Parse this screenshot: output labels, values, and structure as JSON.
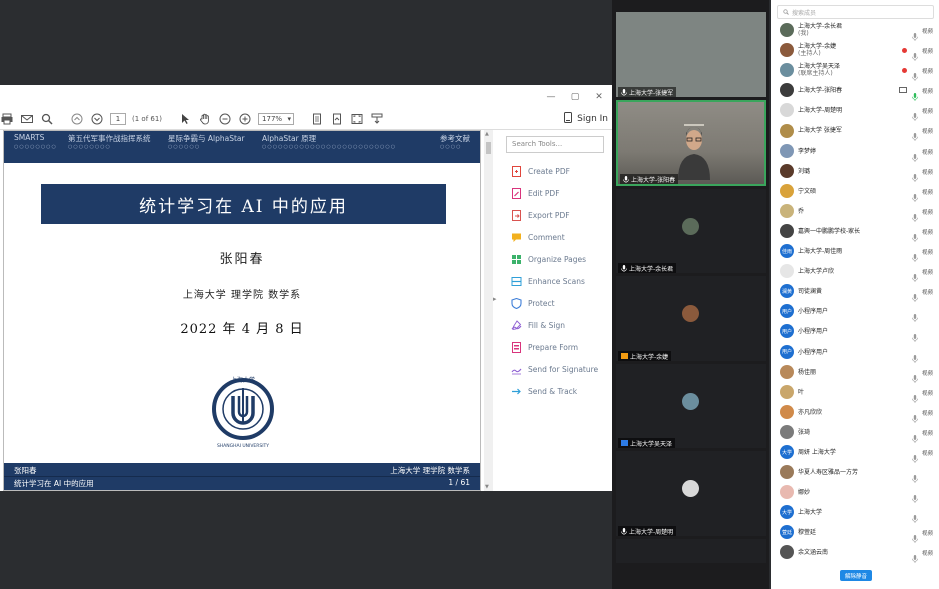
{
  "pdf": {
    "window_controls": [
      "—",
      "▢",
      "✕"
    ],
    "page_current": "1",
    "page_of": "(1 of 61)",
    "zoom": "177%",
    "sign_in": "Sign In",
    "tools_search_placeholder": "Search Tools...",
    "tools": [
      {
        "label": "Create PDF",
        "icon": "create-pdf-icon",
        "color": "#e0463c"
      },
      {
        "label": "Edit PDF",
        "icon": "edit-pdf-icon",
        "color": "#d9347c"
      },
      {
        "label": "Export PDF",
        "icon": "export-pdf-icon",
        "color": "#d9534f"
      },
      {
        "label": "Comment",
        "icon": "comment-icon",
        "color": "#f2b01e"
      },
      {
        "label": "Organize Pages",
        "icon": "organize-pages-icon",
        "color": "#3bb26b"
      },
      {
        "label": "Enhance Scans",
        "icon": "enhance-scans-icon",
        "color": "#2f9fd8"
      },
      {
        "label": "Protect",
        "icon": "protect-icon",
        "color": "#3f7fd8"
      },
      {
        "label": "Fill & Sign",
        "icon": "fill-sign-icon",
        "color": "#8e5fd3"
      },
      {
        "label": "Prepare Form",
        "icon": "prepare-form-icon",
        "color": "#d9347c"
      },
      {
        "label": "Send for Signature",
        "icon": "send-signature-icon",
        "color": "#8e5fd3"
      },
      {
        "label": "Send & Track",
        "icon": "send-track-icon",
        "color": "#2f9fd8"
      }
    ]
  },
  "slide": {
    "nav": [
      "SMARTS",
      "第五代军事作战指挥系统",
      "星际争霸与 AlphaStar",
      "AlphaStar 原理",
      "参考文献"
    ],
    "nav_dots": [
      "○○○○○○○○",
      "○○○○○○○○",
      "○○○○○○",
      "○○○○○○○○○○○○○○○○○○○○○○○○○",
      "○○○○"
    ],
    "title": "统计学习在 AI 中的应用",
    "author": "张阳春",
    "affiliation": "上海大学 理学院 数学系",
    "date": "2022 年 4 月 8 日",
    "logo_top": "上海大学",
    "logo_ring": "SHANGHAI UNIVERSITY",
    "footer_left_1": "张阳春",
    "footer_left_2": "统计学习在 AI 中的应用",
    "footer_right_1": "上海大学 理学院 数学系",
    "footer_right_2": "1 / 61",
    "navy": "#1f3b66"
  },
  "videos": [
    {
      "name": "上海大学-张捷军",
      "type": "blank"
    },
    {
      "name": "上海大学-张阳春",
      "type": "camera"
    },
    {
      "name": "上海大学-余长君",
      "type": "avatar"
    },
    {
      "name": "上海大学-余婕",
      "type": "avatar"
    },
    {
      "name": "上海大学吴天泽",
      "type": "avatar"
    },
    {
      "name": "上海大学-周楚明",
      "type": "avatar"
    }
  ],
  "participants": {
    "search_placeholder": "搜索成员",
    "unmute_all": "解除静音",
    "cam_label": "视频",
    "rows": [
      {
        "name": "上海大学-余长君",
        "sub": "(我)",
        "avatar_color": "#5b6b5a",
        "mic": "gray",
        "cam": true
      },
      {
        "name": "上海大学-余婕",
        "sub": "(主持人)",
        "avatar_color": "#8b5a3c",
        "mic": "gray",
        "cam": true,
        "rec": true
      },
      {
        "name": "上海大学吴天泽",
        "sub": "(联席主持人)",
        "avatar_color": "#6b8e9e",
        "mic": "gray",
        "cam": true,
        "rec": true
      },
      {
        "name": "上海大学-张阳春",
        "sub": "",
        "avatar_color": "#3c3c3c",
        "mic": "green",
        "cam": true,
        "screen": true
      },
      {
        "name": "上海大学-周楚明",
        "sub": "",
        "avatar_color": "#d8d8d8",
        "mic": "gray",
        "cam": true
      },
      {
        "name": "上海大学 张捷军",
        "sub": "",
        "avatar_color": "#b08d4a",
        "mic": "gray",
        "cam": true
      },
      {
        "name": "李梦婷",
        "sub": "",
        "avatar_color": "#7f97b5",
        "mic": "gray",
        "cam": true
      },
      {
        "name": "刘璐",
        "sub": "",
        "avatar_color": "#5a3a2a",
        "mic": "gray",
        "cam": true
      },
      {
        "name": "宁文硕",
        "sub": "",
        "avatar_color": "#d9a23a",
        "mic": "gray",
        "cam": true
      },
      {
        "name": "乔",
        "sub": "",
        "avatar_color": "#c9b37a",
        "mic": "gray",
        "cam": true
      },
      {
        "name": "嘉興一中鹏鹏学校-家长",
        "sub": "",
        "avatar_color": "#444444",
        "mic": "gray",
        "cam": true
      },
      {
        "name": "上海大学-周佳雨",
        "sub": "",
        "avatar_color": "#1e6fd0",
        "badge": "佳雨",
        "mic": "gray",
        "cam": true
      },
      {
        "name": "上海大学卢欣",
        "sub": "",
        "avatar_color": "#e6e6e6",
        "mic": "gray",
        "cam": true
      },
      {
        "name": "司徒澜黄",
        "sub": "",
        "avatar_color": "#1e6fd0",
        "badge": "澜黄",
        "mic": "gray",
        "cam": true
      },
      {
        "name": "小程序用户",
        "sub": "",
        "avatar_color": "#1e6fd0",
        "badge": "用户",
        "mic": "gray",
        "cam": false
      },
      {
        "name": "小程序用户",
        "sub": "",
        "avatar_color": "#1e6fd0",
        "badge": "用户",
        "mic": "gray",
        "cam": false
      },
      {
        "name": "小程序用户",
        "sub": "",
        "avatar_color": "#1e6fd0",
        "badge": "用户",
        "mic": "gray",
        "cam": false
      },
      {
        "name": "杨佳丽",
        "sub": "",
        "avatar_color": "#b8895a",
        "mic": "gray",
        "cam": true
      },
      {
        "name": "叶",
        "sub": "",
        "avatar_color": "#c9a66b",
        "mic": "gray",
        "cam": true
      },
      {
        "name": "亦凡欣欣",
        "sub": "",
        "avatar_color": "#d08a4a",
        "mic": "gray",
        "cam": true
      },
      {
        "name": "张琦",
        "sub": "",
        "avatar_color": "#7b7b7b",
        "mic": "gray",
        "cam": true
      },
      {
        "name": "周妍 上海大学",
        "sub": "",
        "avatar_color": "#1e6fd0",
        "badge": "大学",
        "mic": "gray",
        "cam": true
      },
      {
        "name": "华夏人寿区雅品一方芳",
        "sub": "",
        "avatar_color": "#9a7a5a",
        "mic": "gray",
        "cam": false
      },
      {
        "name": "娜妙",
        "sub": "",
        "avatar_color": "#e8b9b0",
        "mic": "gray",
        "cam": false
      },
      {
        "name": "上海大学",
        "sub": "",
        "avatar_color": "#1e6fd0",
        "badge": "大学",
        "mic": "gray",
        "cam": false
      },
      {
        "name": "穆萱廷",
        "sub": "",
        "avatar_color": "#1e6fd0",
        "badge": "萱廷",
        "mic": "gray",
        "cam": true
      },
      {
        "name": "余文涵云南",
        "sub": "",
        "avatar_color": "#555555",
        "mic": "gray",
        "cam": true
      }
    ]
  }
}
